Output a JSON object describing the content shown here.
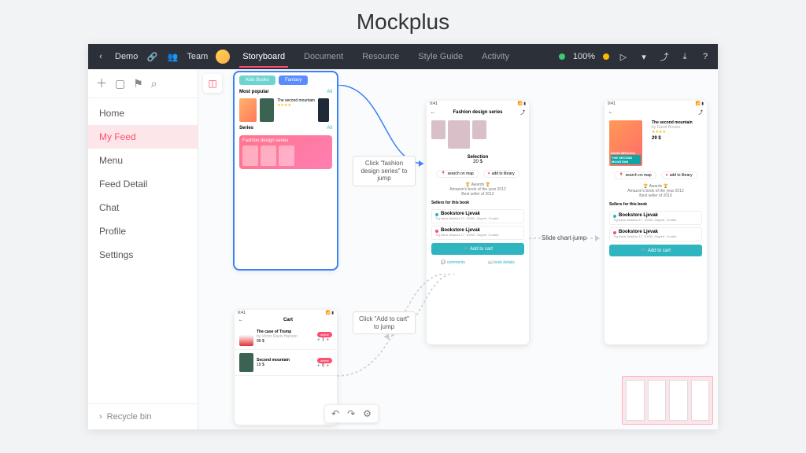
{
  "page_title": "Mockplus",
  "toolbar": {
    "back_label": "Demo",
    "team_label": "Team",
    "tabs": [
      "Storyboard",
      "Document",
      "Resource",
      "Style Guide",
      "Activity"
    ],
    "active_tab": 0,
    "zoom_label": "100%"
  },
  "sidebar": {
    "items": [
      "Home",
      "My Feed",
      "Menu",
      "Feed Detail",
      "Chat",
      "Profile",
      "Settings"
    ],
    "active_index": 1,
    "recycle_label": "Recycle bin"
  },
  "annotations": {
    "jump_fashion": "Click \"fashion design series\" to jump",
    "jump_cart": "Click \"Add to cart\" to jump",
    "slide_jump": "Slide chart jump"
  },
  "feed_mock": {
    "chips": [
      {
        "label": "Kids Books",
        "color": "#6ed4cf"
      },
      {
        "label": "Fantasy",
        "color": "#5b8cff"
      }
    ],
    "section1": {
      "title": "Most popular",
      "all": "All"
    },
    "book1": {
      "title": "The second mountain",
      "stars": "★★★★"
    },
    "section2": {
      "title": "Series",
      "all": "All"
    },
    "series_title": "Fashion design series"
  },
  "detail_mock": {
    "status_time": "9:41",
    "title": "Fashion design series",
    "selection_label": "Selection",
    "price": "20 $",
    "pill_map": "search on map",
    "pill_lib": "add to library",
    "awards_title": "Awards",
    "award1": "Amazon's book of the year 2012",
    "award2": "Best seller of 2012",
    "sellers_title": "Sellers for this book",
    "seller_name": "Bookstore Ljevak",
    "seller_addr": "Trg bana Jelačića 17, 10000, Zagreb, Croatia",
    "atc_label": "Add to cart",
    "foot_left": "comments",
    "foot_right": "book details"
  },
  "cart_mock": {
    "status_time": "9:41",
    "title": "Cart",
    "item1": {
      "title": "The case of Trump",
      "subtitle": "by Victor Davis Hanson",
      "price": "99 $",
      "qty": "1"
    },
    "item2": {
      "title": "Second mountain",
      "price": "19 $",
      "qty": "0"
    },
    "delete_label": "delete"
  },
  "book2_mock": {
    "status_time": "9:41",
    "cover_top": "DAVID BROOKS",
    "cover_mid": "THE SECOND MOUNTAIN",
    "title": "The second mountain",
    "author": "by David Brooks",
    "stars": "★★★★",
    "price": "29 $",
    "pill_map": "search on map",
    "pill_lib": "add to library",
    "awards_title": "Awards",
    "award1": "Amazon's book of the year 2012",
    "award2": "Best seller of 2019",
    "sellers_title": "Sellers for this book",
    "seller_name": "Bookstore Ljevak",
    "seller_addr": "Trg bana Jelačića 17, 10000, Zagreb, Croatia",
    "atc_label": "Add to cart"
  }
}
